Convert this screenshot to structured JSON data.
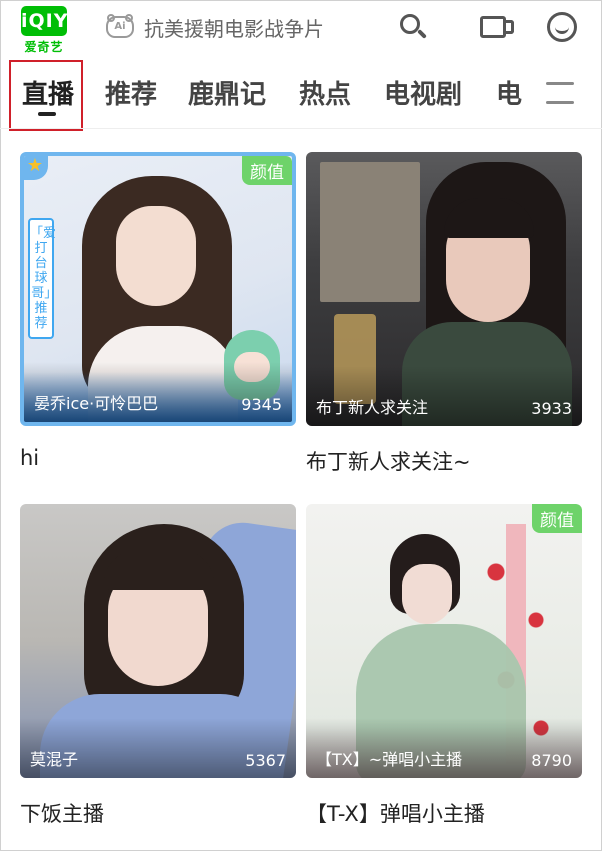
{
  "app": {
    "logo_text": "iQIYI",
    "logo_subtext": "爱奇艺"
  },
  "search": {
    "ai_badge": "Ai",
    "placeholder": "抗美援朝电影战争片"
  },
  "tabs": [
    {
      "label": "直播",
      "active": true
    },
    {
      "label": "推荐",
      "active": false
    },
    {
      "label": "鹿鼎记",
      "active": false
    },
    {
      "label": "热点",
      "active": false
    },
    {
      "label": "电视剧",
      "active": false
    },
    {
      "label": "电",
      "active": false
    }
  ],
  "cards": [
    {
      "badge": "颜值",
      "side_tag": "「爱打台球哥」推荐",
      "streamer": "晏乔ice·可怜巴巴",
      "viewers": "9345",
      "title": "hi"
    },
    {
      "badge": "",
      "streamer": "布丁新人求关注",
      "viewers": "3933",
      "title": "布丁新人求关注~"
    },
    {
      "badge": "",
      "streamer": "莫混子",
      "viewers": "5367",
      "title": "下饭主播"
    },
    {
      "badge": "颜值",
      "streamer": "【TX】~弹唱小主播",
      "viewers": "8790",
      "title": "【T-X】弹唱小主播"
    }
  ],
  "colors": {
    "brand_green": "#00be06",
    "badge_green": "#6ed36a",
    "highlight_red": "#d0202a"
  }
}
